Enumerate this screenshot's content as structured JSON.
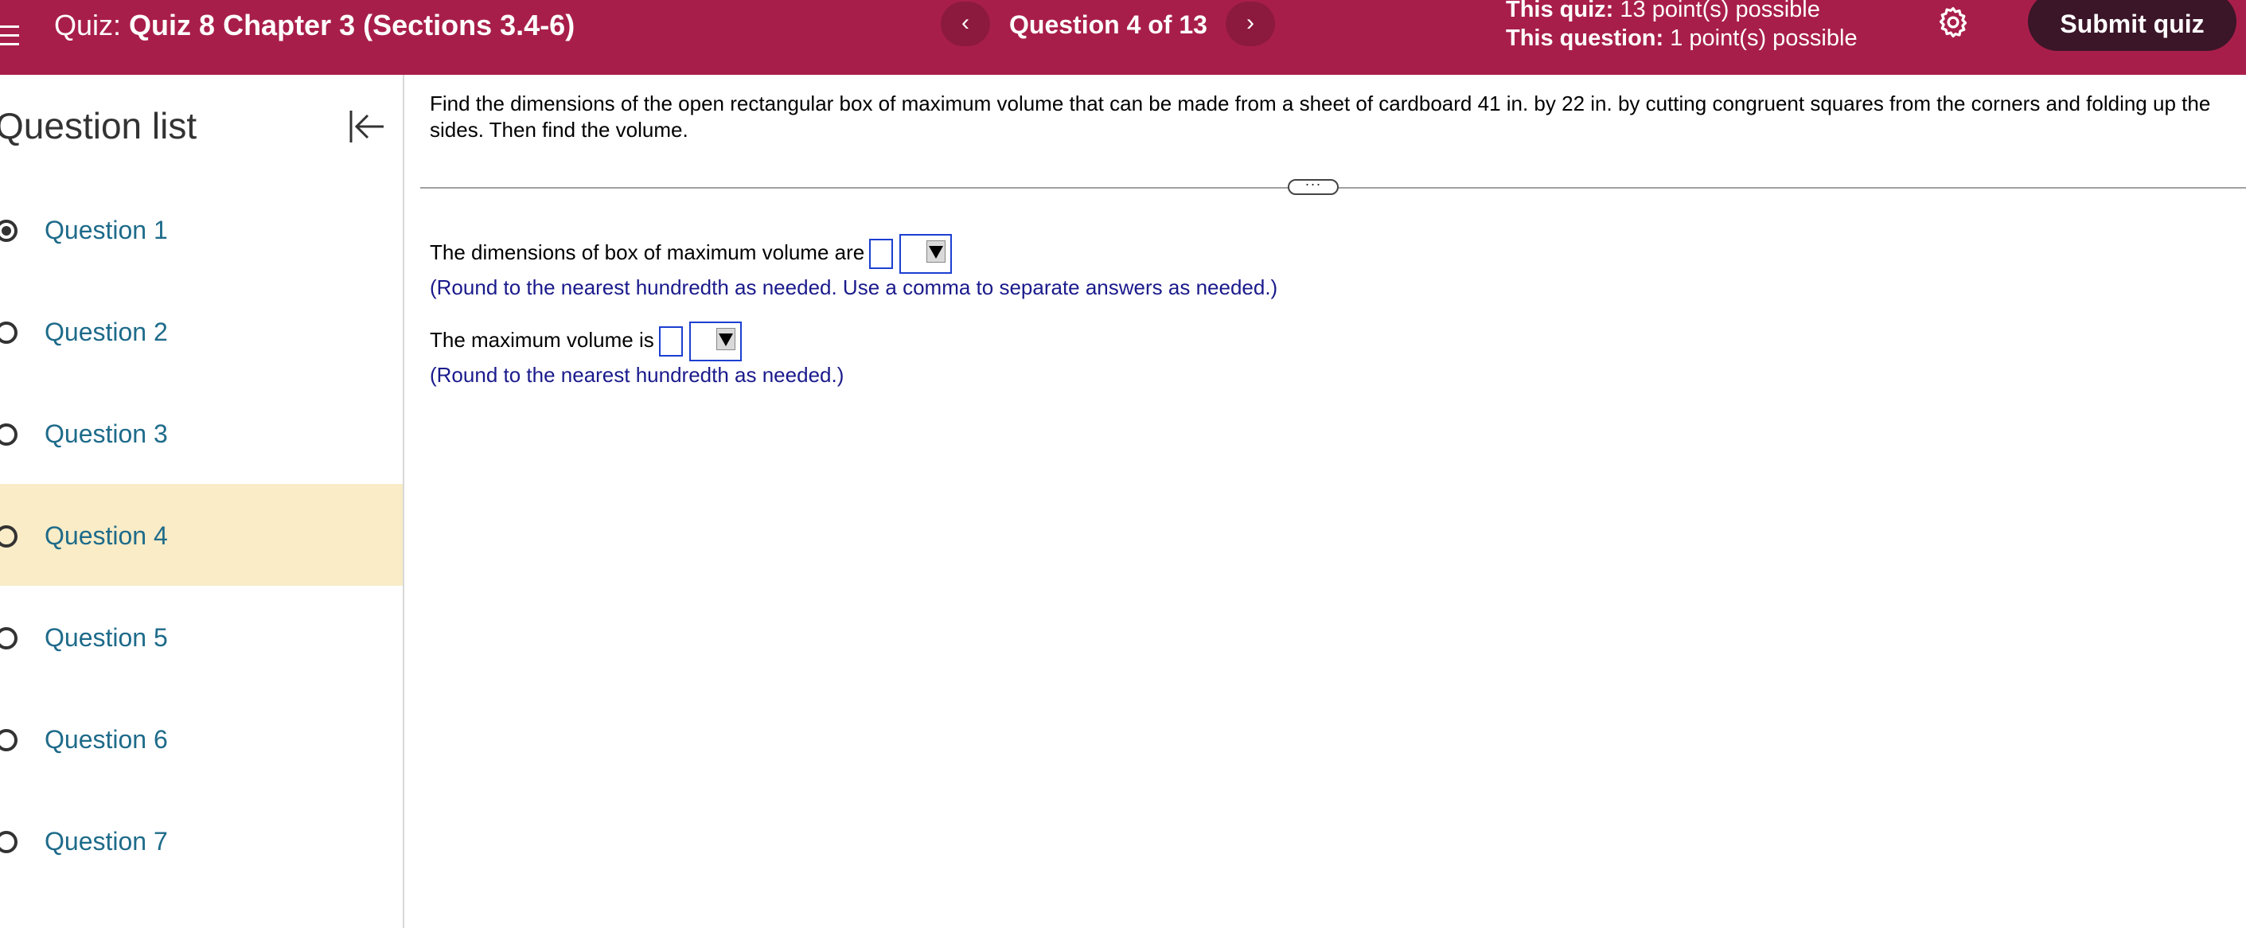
{
  "header": {
    "quiz_prefix": "Quiz:",
    "quiz_name": "Quiz 8 Chapter 3 (Sections 3.4-6)",
    "prev_label": "‹",
    "next_label": "›",
    "question_indicator": "Question 4 of 13",
    "quiz_points_label": "This quiz:",
    "quiz_points_value": "13 point(s) possible",
    "question_points_label": "This question:",
    "question_points_value": "1 point(s) possible",
    "submit_label": "Submit quiz",
    "icons": [
      "menu-icon",
      "chevron-left-icon",
      "chevron-right-icon",
      "gear-icon"
    ]
  },
  "sidebar": {
    "title": "Question list",
    "collapse_icon": "collapse-left-icon",
    "items": [
      {
        "label": "Question 1",
        "selected": true,
        "current": false
      },
      {
        "label": "Question 2",
        "selected": false,
        "current": false
      },
      {
        "label": "Question 3",
        "selected": false,
        "current": false
      },
      {
        "label": "Question 4",
        "selected": false,
        "current": true
      },
      {
        "label": "Question 5",
        "selected": false,
        "current": false
      },
      {
        "label": "Question 6",
        "selected": false,
        "current": false
      },
      {
        "label": "Question 7",
        "selected": false,
        "current": false
      }
    ]
  },
  "question": {
    "text": "Find the dimensions of the open rectangular box of maximum volume that can be made from a sheet of cardboard 41 in. by 22 in. by cutting congruent squares from the corners and folding up the sides. Then find the volume.",
    "divider_handle": "···",
    "parts": [
      {
        "prompt": "The dimensions of box of maximum volume are",
        "input_value": "",
        "unit_value": "",
        "hint": "(Round to the nearest hundredth as needed. Use a comma to separate answers as needed.)"
      },
      {
        "prompt": "The maximum volume is",
        "input_value": "",
        "unit_value": "",
        "hint": "(Round to the nearest hundredth as needed.)"
      }
    ]
  },
  "colors": {
    "header_bg": "#a81e4b",
    "submit_bg": "#3b1528",
    "current_item_bg": "#f9ecc7",
    "link_blue": "#1e6b8a",
    "hint_blue": "#1a1a8c",
    "input_border": "#1c3fd1"
  }
}
